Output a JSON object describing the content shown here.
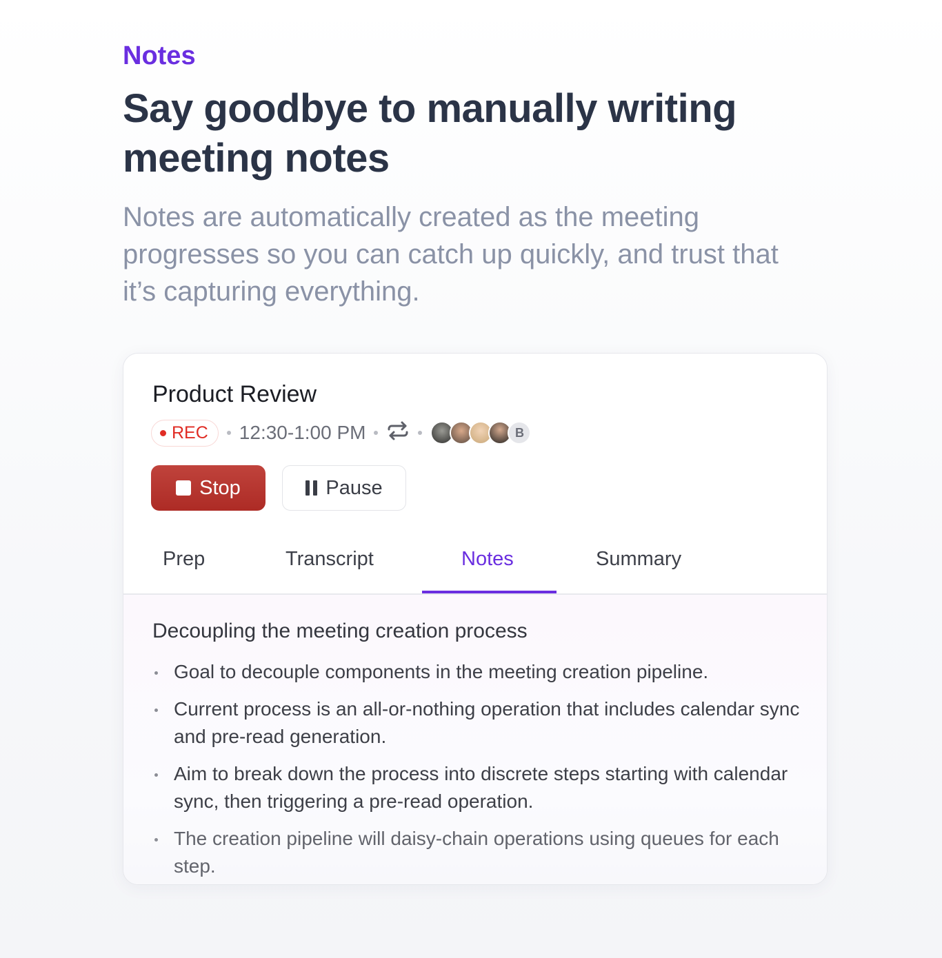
{
  "eyebrow": "Notes",
  "headline": "Say goodbye to manually writing meeting notes",
  "subtitle": "Notes are automatically created as the meeting progresses so you can catch up quickly, and trust that it’s capturing everything.",
  "colors": {
    "accent": "#6a2ee0",
    "record": "#e02c24",
    "stop": "#b8352f"
  },
  "meeting": {
    "title": "Product Review",
    "rec_label": "REC",
    "time": "12:30-1:00 PM",
    "repeat_icon": "repeat-icon",
    "avatars": [
      "avatar-photo",
      "avatar-photo",
      "avatar-photo",
      "avatar-photo"
    ],
    "extra_avatar_initial": "B",
    "stop_label": "Stop",
    "pause_label": "Pause"
  },
  "tabs": [
    {
      "label": "Prep",
      "active": false
    },
    {
      "label": "Transcript",
      "active": false
    },
    {
      "label": "Notes",
      "active": true
    },
    {
      "label": "Summary",
      "active": false
    }
  ],
  "notes": {
    "heading": "Decoupling the meeting creation process",
    "bullets": [
      "Goal to decouple components in the meeting creation pipeline.",
      "Current process is an all-or-nothing operation that includes calendar sync and pre-read generation.",
      "Aim to break down the process into discrete steps starting with calendar sync, then triggering a pre-read operation.",
      "The creation pipeline will daisy-chain operations using queues for each step."
    ]
  }
}
